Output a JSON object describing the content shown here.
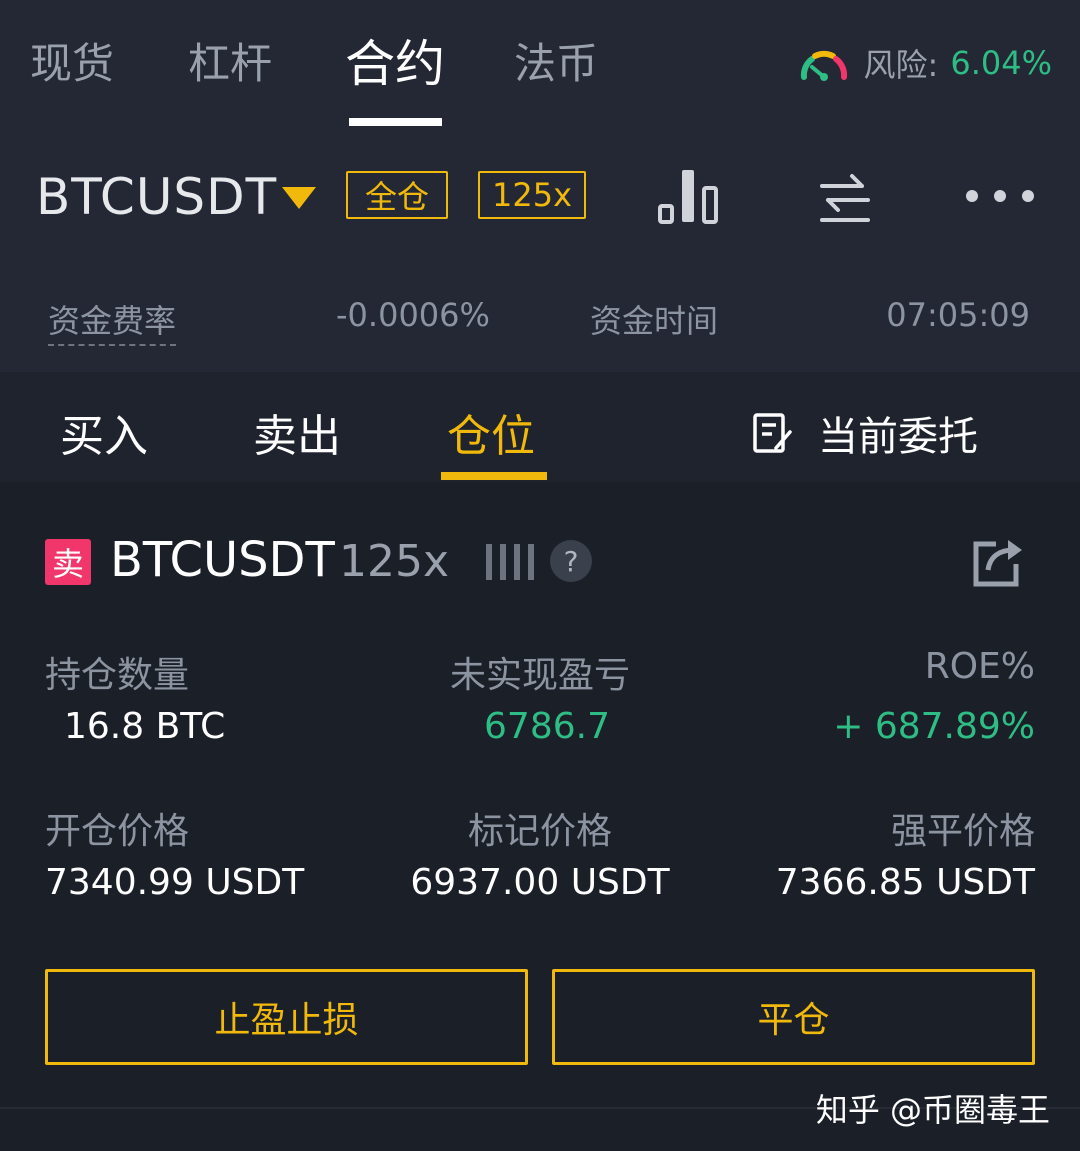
{
  "main_tabs": [
    {
      "label": "现货"
    },
    {
      "label": "杠杆"
    },
    {
      "label": "合约"
    },
    {
      "label": "法币"
    }
  ],
  "risk": {
    "label": "风险:",
    "value": "6.04%"
  },
  "symbol_bar": {
    "symbol": "BTCUSDT",
    "margin_mode": "全仓",
    "leverage": "125x"
  },
  "funding": {
    "rate_label": "资金费率",
    "rate_value": "-0.0006%",
    "time_label": "资金时间",
    "countdown": "07:05:09"
  },
  "order_tabs": [
    {
      "label": "买入"
    },
    {
      "label": "卖出"
    },
    {
      "label": "仓位"
    }
  ],
  "open_orders": {
    "label": "当前委托"
  },
  "position": {
    "side_badge": "卖",
    "symbol": "BTCUSDT",
    "leverage": "125x",
    "help": "?",
    "size_label": "持仓数量",
    "size_value": "16.8  BTC",
    "pnl_label": "未实现盈亏",
    "pnl_value": "6786.7",
    "roe_label": "ROE%",
    "roe_value": "+ 687.89%",
    "entry_label": "开仓价格",
    "entry_value": "7340.99 USDT",
    "mark_label": "标记价格",
    "mark_value": "6937.00 USDT",
    "liq_label": "强平价格",
    "liq_value": "7366.85 USDT"
  },
  "buttons": {
    "tpsl": "止盈止损",
    "close": "平仓"
  },
  "watermark": "知乎 @币圈毒王",
  "colors": {
    "accent": "#f0b90b",
    "profit": "#2ebd85",
    "sell": "#f0366a",
    "background": "#1b1f28"
  }
}
